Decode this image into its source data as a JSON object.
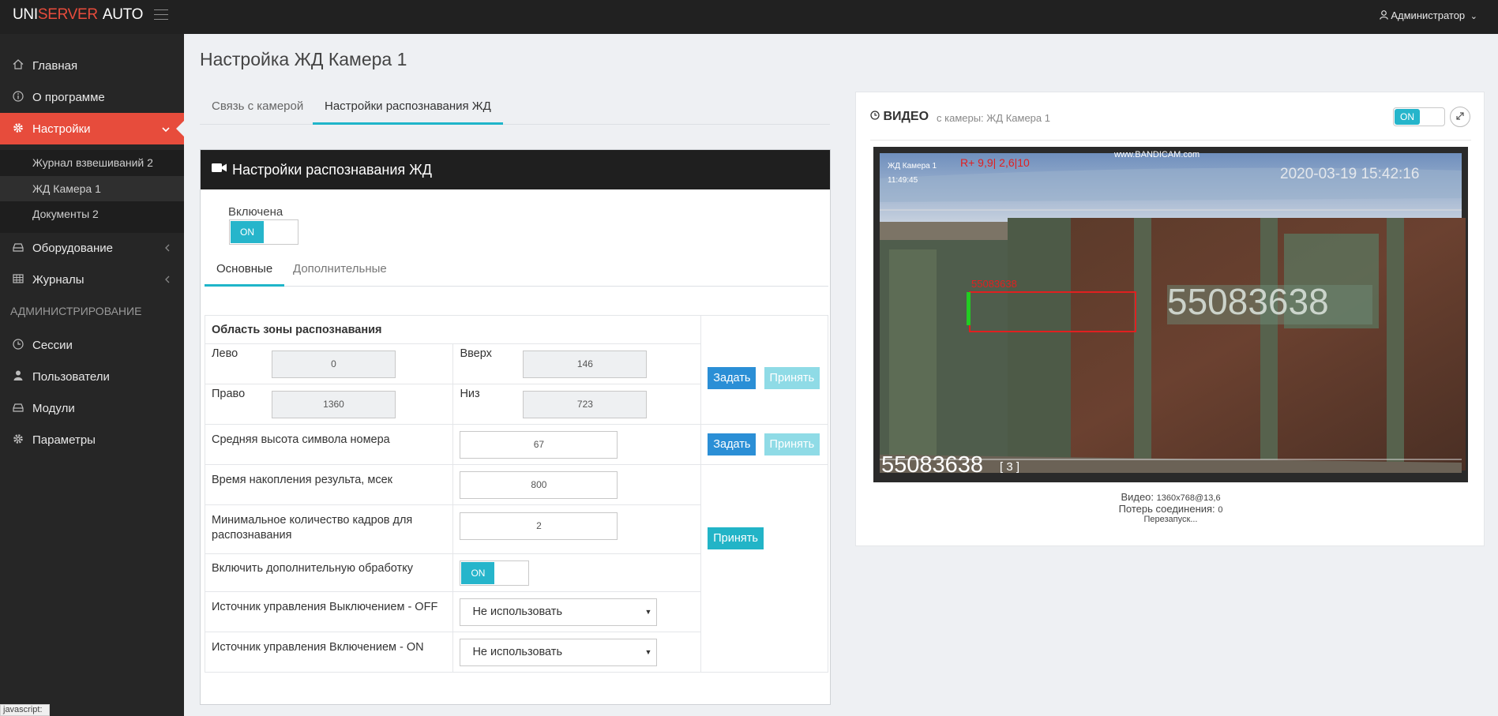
{
  "header": {
    "logo_part1": "UNI",
    "logo_part2": "SERVER",
    "logo_part3": "AUTO",
    "user": "Администратор",
    "user_caret": "⌄",
    "user_icon": "user-icon"
  },
  "sidebar": {
    "items": [
      {
        "label": "Главная",
        "icon": "home-icon"
      },
      {
        "label": "О программе",
        "icon": "info-icon"
      },
      {
        "label": "Настройки",
        "icon": "gear-icon"
      },
      {
        "label": "Оборудование",
        "icon": "hdd-icon"
      },
      {
        "label": "Журналы",
        "icon": "table-icon"
      }
    ],
    "submenu": [
      "Журнал взвешиваний 2",
      "ЖД Камера 1",
      "Документы 2"
    ],
    "section_title": "АДМИНИСТРИРОВАНИЕ",
    "admin_items": [
      {
        "label": "Сессии",
        "icon": "clock-icon"
      },
      {
        "label": "Пользователи",
        "icon": "user-icon"
      },
      {
        "label": "Модули",
        "icon": "hdd-icon"
      },
      {
        "label": "Параметры",
        "icon": "gear-icon"
      }
    ]
  },
  "page": {
    "title": "Настройка ЖД Камера 1",
    "tabs": [
      "Связь с камерой",
      "Настройки распознавания ЖД"
    ]
  },
  "panel": {
    "title": "Настройки распознавания ЖД",
    "enabled_label": "Включена",
    "enabled_toggle": "ON",
    "subtabs": [
      "Основные",
      "Дополнительные"
    ],
    "area_title": "Область зоны распознавания",
    "left_label": "Лево",
    "left_value": "0",
    "top_label": "Вверх",
    "top_value": "146",
    "right_label": "Право",
    "right_value": "1360",
    "bottom_label": "Низ",
    "bottom_value": "723",
    "btn_set": "Задать",
    "btn_accept": "Принять",
    "avg_height_label": "Средняя высота символа номера",
    "avg_height_value": "67",
    "accum_label": "Время накопления результа, мсек",
    "accum_value": "800",
    "min_frames_label": "Минимальное количество кадров для распознавания",
    "min_frames_value": "2",
    "extra_proc_label": "Включить дополнительную обработку",
    "extra_proc_toggle": "ON",
    "off_source_label": "Источник управления Выключением - OFF",
    "off_source_value": "Не использовать",
    "on_source_label": "Источник управления Включением - ON",
    "on_source_value": "Не использовать",
    "select_arrow": "▼"
  },
  "video": {
    "title": "ВИДЕО",
    "subtitle": "с камеры: ЖД Камера 1",
    "toggle": "ON",
    "overlay_cam_name": "ЖД Камера 1",
    "overlay_time_small": "11:49:45",
    "overlay_r": "R+  9,9| 2,6|10",
    "overlay_watermark": "www.BANDICAM.com",
    "overlay_datetime": "2020-03-19 15:42:16",
    "overlay_box_label": "55083638",
    "overlay_plate": "55083638",
    "overlay_count": "[ 3 ]",
    "stats_label": "Видео:",
    "stats_value": "1360x768@13,6",
    "lost_label": "Потерь соединения:",
    "lost_value": "0",
    "restart": "Перезапуск..."
  },
  "status_bar": "javascript:",
  "colors": {
    "accent": "#e74c3c",
    "teal": "#26b5cb",
    "blue": "#2b8fd6"
  }
}
